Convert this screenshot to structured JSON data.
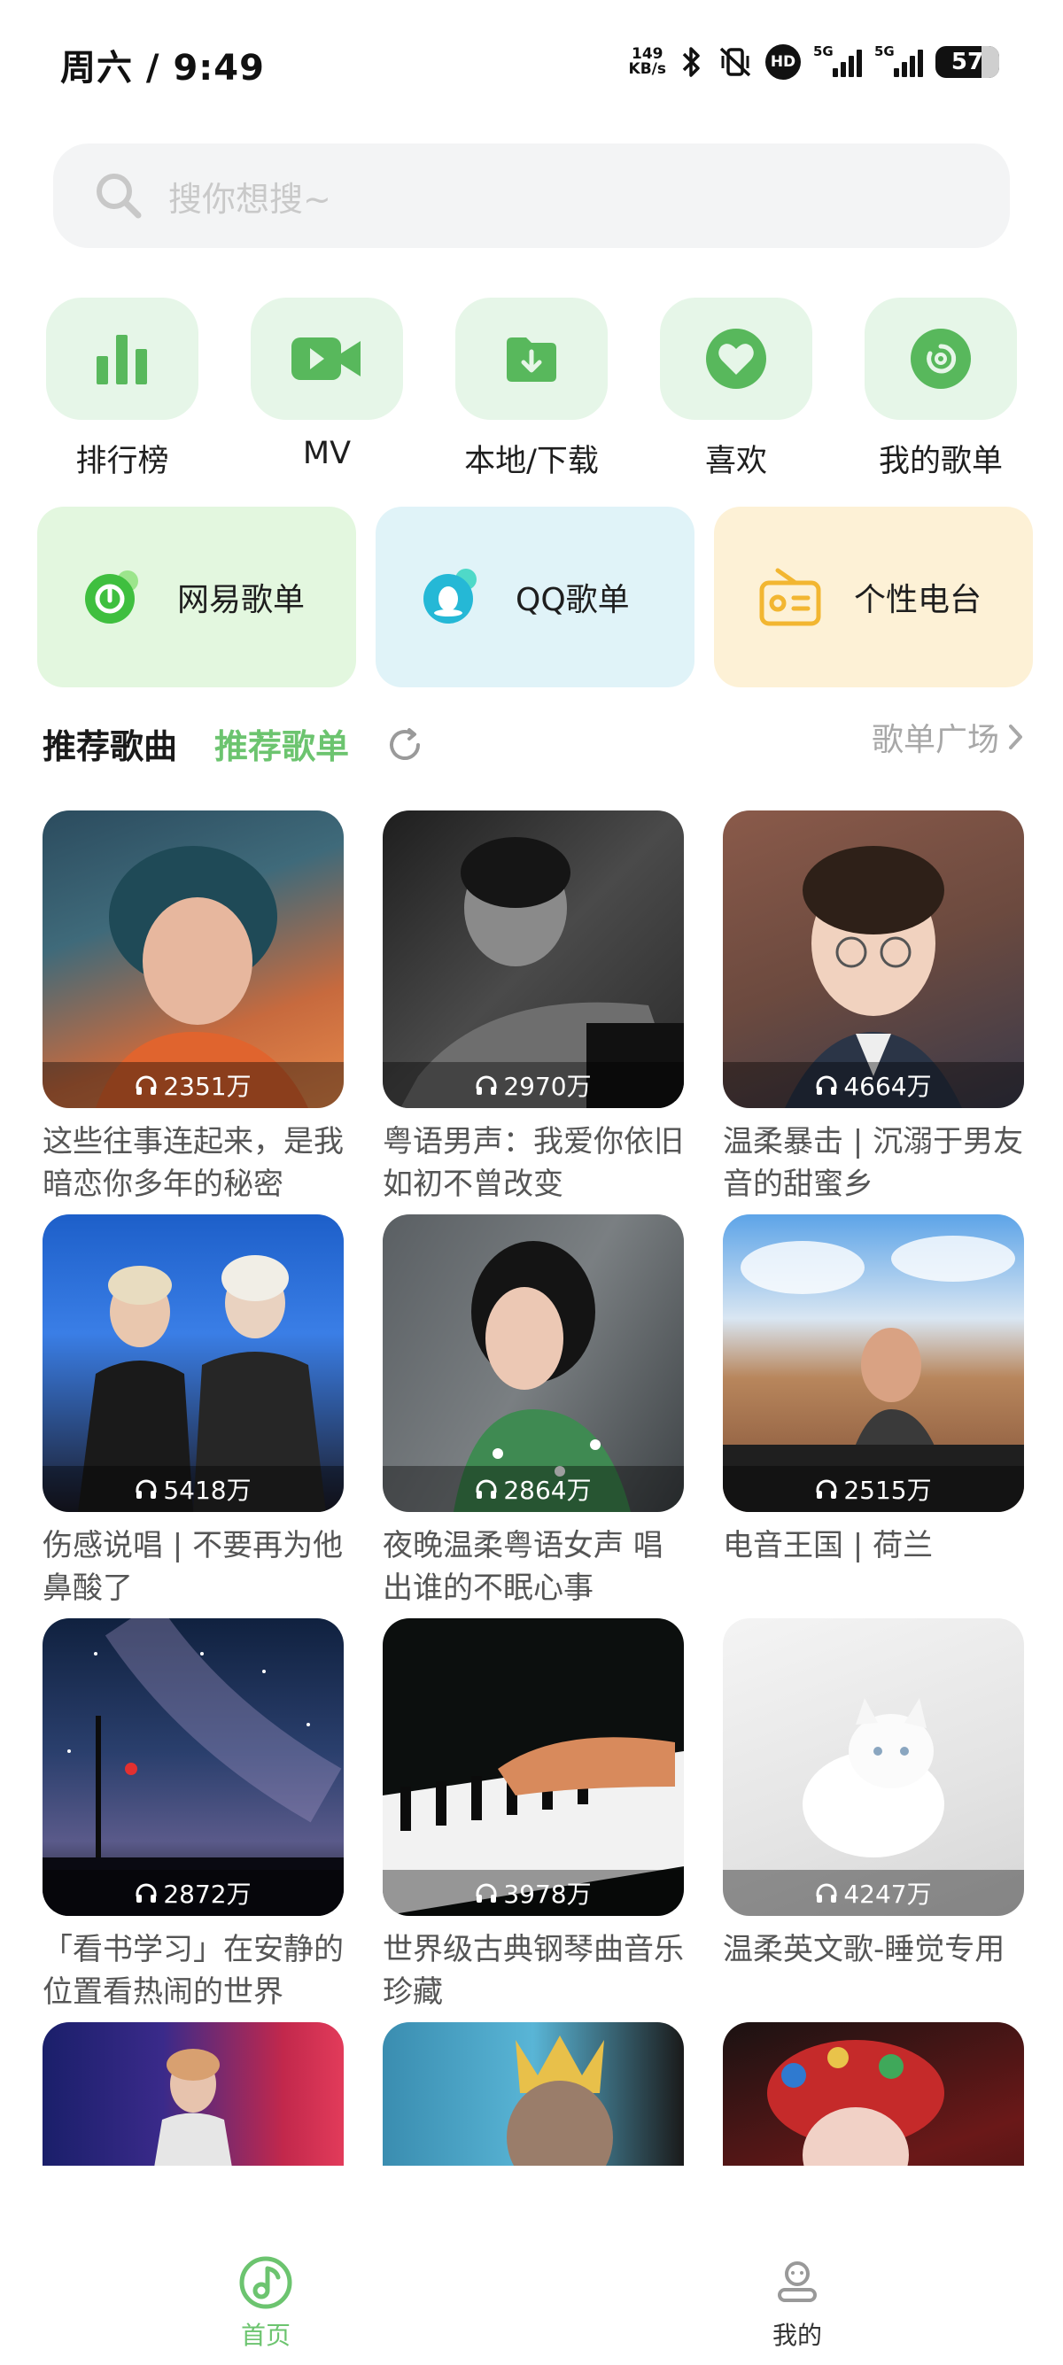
{
  "status_bar": {
    "time": "周六 / 9:49",
    "net_speed_value": "149",
    "net_speed_unit": "KB/s",
    "signal_tag_1": "5G",
    "signal_tag_2": "5G",
    "hd_badge": "HD",
    "battery": "57"
  },
  "search": {
    "placeholder": "搜你想搜~"
  },
  "quick_actions": [
    {
      "label": "排行榜",
      "icon": "chart-bars-icon"
    },
    {
      "label": "MV",
      "icon": "video-camera-icon"
    },
    {
      "label": "本地/下载",
      "icon": "download-folder-icon"
    },
    {
      "label": "喜欢",
      "icon": "heart-icon"
    },
    {
      "label": "我的歌单",
      "icon": "disc-icon"
    }
  ],
  "sources": [
    {
      "label": "网易歌单",
      "icon": "netease-icon",
      "bg": "#e3f7df"
    },
    {
      "label": "QQ歌单",
      "icon": "qq-penguin-icon",
      "bg": "#e0f3f8"
    },
    {
      "label": "个性电台",
      "icon": "radio-icon",
      "bg": "#fdf1d6"
    }
  ],
  "section": {
    "tab_songs": "推荐歌曲",
    "tab_playlists": "推荐歌单",
    "plaza": "歌单广场"
  },
  "playlists": [
    {
      "count": "2351万",
      "title": "这些往事连起来，是我暗恋你多年的秘密"
    },
    {
      "count": "2970万",
      "title": "粤语男声：我爱你依旧如初不曾改变"
    },
    {
      "count": "4664万",
      "title": "温柔暴击 | 沉溺于男友音的甜蜜乡"
    },
    {
      "count": "5418万",
      "title": "伤感说唱 | 不要再为他鼻酸了"
    },
    {
      "count": "2864万",
      "title": "夜晚温柔粤语女声 唱出谁的不眠心事"
    },
    {
      "count": "2515万",
      "title": "电音王国 | 荷兰"
    },
    {
      "count": "2872万",
      "title": "「看书学习」在安静的位置看热闹的世界"
    },
    {
      "count": "3978万",
      "title": "世界级古典钢琴曲音乐珍藏"
    },
    {
      "count": "4247万",
      "title": "温柔英文歌-睡觉专用"
    },
    {
      "count": "",
      "title": ""
    },
    {
      "count": "",
      "title": ""
    },
    {
      "count": "",
      "title": ""
    }
  ],
  "bottom_nav": [
    {
      "label": "首页",
      "active": true
    },
    {
      "label": "我的",
      "active": false
    }
  ],
  "colors": {
    "accent": "#6cc46f",
    "quick_bg": "#e6f6e8",
    "search_bg": "#f3f4f5"
  }
}
